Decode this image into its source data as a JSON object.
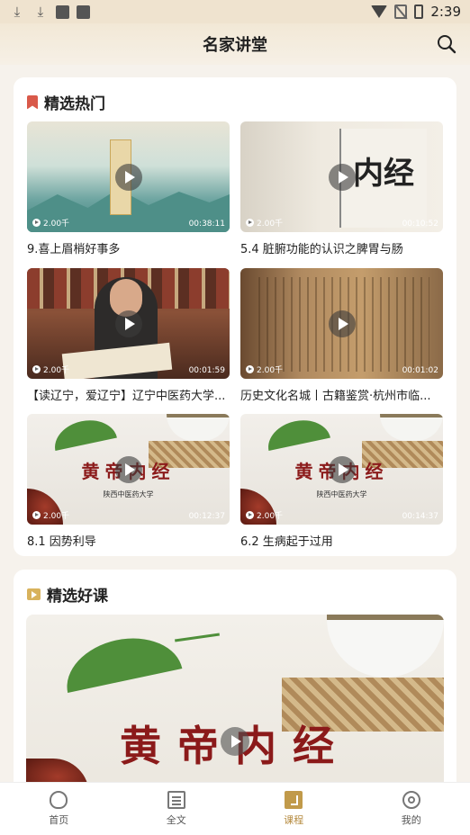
{
  "status_bar": {
    "time": "2:39",
    "icons": [
      "download-icon",
      "download-icon",
      "notification-icon",
      "notification-icon",
      "wifi-icon",
      "no-sim-icon",
      "battery-icon"
    ]
  },
  "header": {
    "title": "名家讲堂",
    "search_icon": "search-icon"
  },
  "featured_hot": {
    "title": "精选热门",
    "icon": "bookmark-icon",
    "videos": [
      {
        "title": "9.喜上眉梢好事多",
        "views": "2.00千",
        "duration": "00:38:11"
      },
      {
        "title": "5.4 脏腑功能的认识之脾胃与肠",
        "views": "2.00千",
        "duration": "00:10:52"
      },
      {
        "title": "【读辽宁，爱辽宁】辽宁中医药大学...",
        "views": "2.00千",
        "duration": "00:01:59"
      },
      {
        "title": "历史文化名城丨古籍鉴赏·杭州市临...",
        "views": "2.00千",
        "duration": "00:01:02"
      },
      {
        "title": "8.1  因势利导",
        "views": "2.00千",
        "duration": "00:12:37"
      },
      {
        "title": "6.2  生病起于过用",
        "views": "2.00千",
        "duration": "00:14:37"
      }
    ]
  },
  "thumb_text": {
    "herb_seal": "黄帝内经",
    "herb_sub": "陕西中医药大学",
    "book_big": "内经"
  },
  "featured_courses": {
    "title": "精选好课",
    "icon": "tv-icon"
  },
  "tabbar": {
    "tabs": [
      {
        "label": "首页",
        "icon": "home-icon"
      },
      {
        "label": "全文",
        "icon": "text-icon"
      },
      {
        "label": "课程",
        "icon": "course-icon",
        "active": true
      },
      {
        "label": "我的",
        "icon": "mine-icon"
      }
    ]
  }
}
